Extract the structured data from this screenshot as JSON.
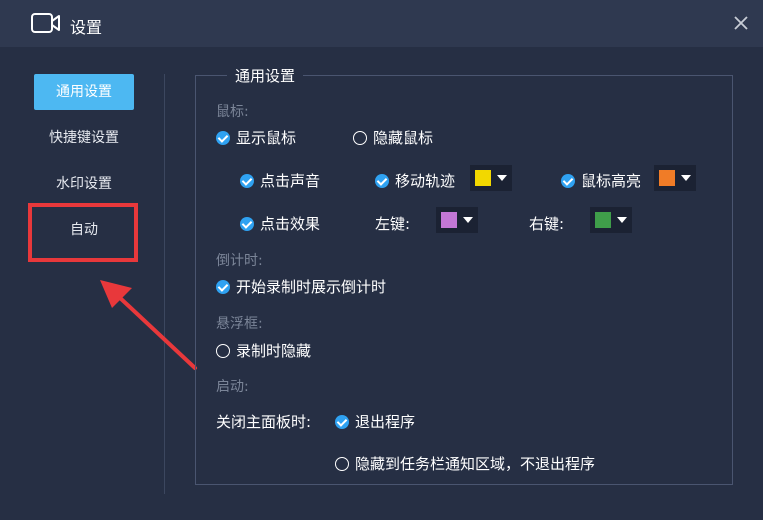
{
  "window": {
    "title": "设置",
    "close_icon": "close-icon",
    "app_icon": "video-camera-icon"
  },
  "sidebar": {
    "items": [
      {
        "label": "通用设置",
        "active": true
      },
      {
        "label": "快捷键设置",
        "active": false
      },
      {
        "label": "水印设置",
        "active": false
      },
      {
        "label": "自动",
        "active": false
      }
    ]
  },
  "general": {
    "legend": "通用设置",
    "mouse": {
      "label": "鼠标:",
      "show": {
        "label": "显示鼠标",
        "checked": true
      },
      "hide": {
        "label": "隐藏鼠标",
        "checked": false
      },
      "click_sound": {
        "label": "点击声音",
        "checked": true
      },
      "move_track": {
        "label": "移动轨迹",
        "checked": true,
        "color": "#f2d800"
      },
      "highlight": {
        "label": "鼠标高亮",
        "checked": true,
        "color": "#f07c27"
      },
      "click_effect": {
        "label": "点击效果",
        "checked": true
      },
      "left_key": {
        "label": "左键:",
        "color": "#c377d6"
      },
      "right_key": {
        "label": "右键:",
        "color": "#3f9e4a"
      }
    },
    "countdown": {
      "label": "倒计时:",
      "show": {
        "label": "开始录制时展示倒计时",
        "checked": true
      }
    },
    "float": {
      "label": "悬浮框:",
      "hide_when_recording": {
        "label": "录制时隐藏",
        "checked": false
      }
    },
    "startup": {
      "label": "启动:",
      "close_panel_label": "关闭主面板时:",
      "exit": {
        "label": "退出程序",
        "checked": true
      },
      "minimize": {
        "label": "隐藏到任务栏通知区域，不退出程序",
        "checked": false
      }
    }
  },
  "annotation": {
    "color": "#e8383b"
  }
}
